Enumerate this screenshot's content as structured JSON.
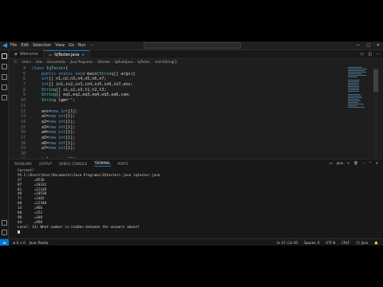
{
  "titlebar": {
    "menus": [
      "File",
      "Edit",
      "Selection",
      "View",
      "Go",
      "Run"
    ],
    "menu_more": "···",
    "search": "",
    "controls": [
      "—",
      "□",
      "✕"
    ]
  },
  "tabs": [
    {
      "label": "Welcome",
      "icon": "vscode-icon"
    },
    {
      "label": "IqTester.java",
      "icon": "java-icon"
    }
  ],
  "breadcrumb": [
    "C:",
    "Users",
    "User",
    "Documents",
    "Java Programs",
    "IQtester",
    "IqRulesJava",
    "IqTester",
    "main(String[])"
  ],
  "editor": {
    "lines": [
      {
        "n": "4",
        "code": "class IqTester{"
      },
      {
        "n": "5",
        "code": "    public static void main(String[] args){"
      },
      {
        "n": "6",
        "code": "    int[] n1,n2,n3,n4,n5,n6,n7;"
      },
      {
        "n": "7",
        "code": "    int[] in1,in2,in3,in4,in5,in6,in7,ans;"
      },
      {
        "n": "8",
        "code": "    String[] s1,s2,s3,t1,t2,t3;"
      },
      {
        "n": "9",
        "code": "    String[] eq1,eq2,eq3,eq4,eq5,eq6,com;"
      },
      {
        "n": "10",
        "code": "    String lgm=\"\";"
      },
      {
        "n": "11",
        "code": ""
      },
      {
        "n": "12",
        "code": "    ans=new int[1];"
      },
      {
        "n": "13",
        "code": "    a1=new int[1];"
      },
      {
        "n": "14",
        "code": "    a2=new int[1];"
      },
      {
        "n": "15",
        "code": "    a3=new int[1];"
      },
      {
        "n": "16",
        "code": "    a4=new int[1];"
      },
      {
        "n": "17",
        "code": "    a5=new int[1];"
      },
      {
        "n": "18",
        "code": "    a6=new int[1];"
      },
      {
        "n": "19",
        "code": "    a7=new int[1];"
      },
      {
        "n": "20",
        "code": ""
      },
      {
        "n": "21",
        "code": "    in1=new int[1];"
      }
    ]
  },
  "panel": {
    "tabs": [
      "PROBLEMS",
      "OUTPUT",
      "DEBUG CONSOLE",
      "TERMINAL",
      "PORTS"
    ],
    "active_tab": "TERMINAL",
    "tools_label": "java",
    "terminal": [
      "Correct!",
      "PS C:\\Users\\User\\Documents\\Java Programs\\IQtester> java iqtester.java",
      "37      =8526",
      "87      =10332",
      "61      =12148",
      "40      =10530",
      "71      =1462",
      "60      =12348",
      "14      =966",
      "60      =252",
      "98      =108",
      "44      =990",
      "Level: 13) What number is hidden between the answers above?"
    ]
  },
  "statusbar": {
    "left": [
      "⊗ 0  ⚠ 0",
      "Java: Ready"
    ],
    "right": [
      "Ln 27, Col 30",
      "Spaces: 4",
      "UTF-8",
      "CRLF",
      "{} Java",
      "🔔"
    ]
  }
}
